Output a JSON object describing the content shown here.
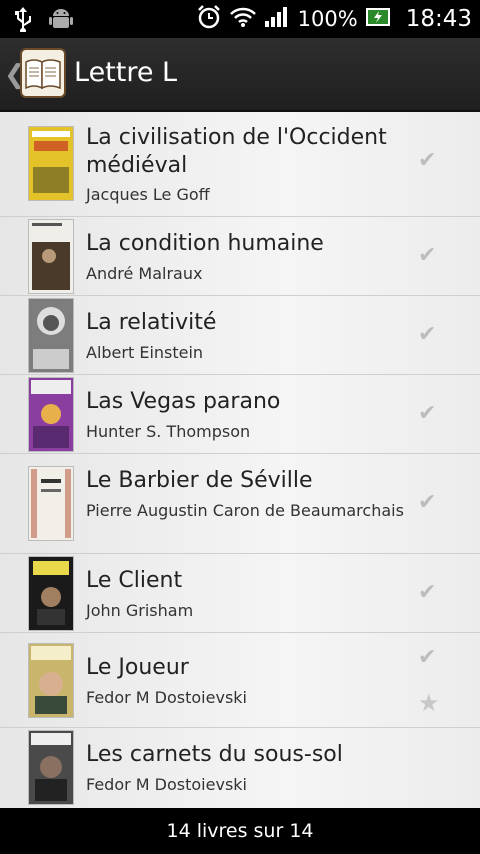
{
  "statusbar": {
    "battery": "100%",
    "time": "18:43"
  },
  "actionbar": {
    "title": "Lettre L"
  },
  "books": [
    {
      "title": "La civilisation de l'Occident médiéval",
      "author": "Jacques Le Goff",
      "read": true,
      "favorite": false,
      "cover_color": "#e3c22a"
    },
    {
      "title": "La condition humaine",
      "author": "André Malraux",
      "read": true,
      "favorite": false,
      "cover_color": "#5a4a3a"
    },
    {
      "title": "La relativité",
      "author": "Albert Einstein",
      "read": true,
      "favorite": false,
      "cover_color": "#7d7d7d"
    },
    {
      "title": "Las Vegas parano",
      "author": "Hunter S. Thompson",
      "read": true,
      "favorite": false,
      "cover_color": "#8a3fa0"
    },
    {
      "title": "Le Barbier de Séville",
      "author": "Pierre Augustin Caron de Beaumarchais",
      "read": true,
      "favorite": false,
      "cover_color": "#f2efe8"
    },
    {
      "title": "Le Client",
      "author": "John Grisham",
      "read": true,
      "favorite": false,
      "cover_color": "#1a1a1a"
    },
    {
      "title": "Le Joueur",
      "author": "Fedor M Dostoievski",
      "read": true,
      "favorite": true,
      "cover_color": "#c9b56b"
    },
    {
      "title": "Les carnets du sous-sol",
      "author": "Fedor M Dostoievski",
      "read": false,
      "favorite": false,
      "cover_color": "#4a4a4a"
    }
  ],
  "footer": {
    "count_label": "14 livres sur 14"
  }
}
